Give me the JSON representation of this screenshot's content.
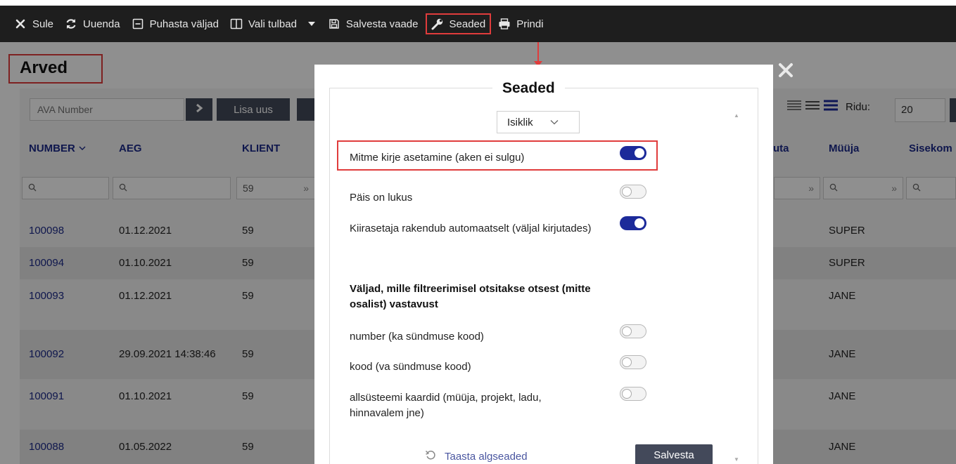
{
  "toolbar": {
    "close": "Sule",
    "refresh": "Uuenda",
    "clear": "Puhasta väljad",
    "columns": "Vali tulbad",
    "save_view": "Salvesta vaade",
    "settings": "Seaded",
    "print": "Prindi"
  },
  "page": {
    "title": "Arved",
    "search_placeholder": "AVA Number",
    "add_new": "Lisa uus",
    "rows_label": "Ridu:",
    "rows_value": "20"
  },
  "table": {
    "headers": {
      "number": "NUMBER",
      "time": "AEG",
      "client": "KLIENT",
      "currency_partial": "uta",
      "seller": "Müüja",
      "internal_partial": "Sisekom"
    },
    "filters": {
      "client": "59"
    },
    "rows": [
      {
        "number": "100098",
        "date": "01.12.2021",
        "client": "59",
        "seller": "SUPER"
      },
      {
        "number": "100094",
        "date": "01.10.2021",
        "client": "59",
        "seller": "SUPER"
      },
      {
        "number": "100093",
        "date": "01.12.2021",
        "client": "59",
        "seller": "JANE"
      },
      {
        "number": "100092",
        "date": "29.09.2021 14:38:46",
        "client": "59",
        "seller": "JANE"
      },
      {
        "number": "100091",
        "date": "01.10.2021",
        "client": "59",
        "seller": "JANE"
      },
      {
        "number": "100088",
        "date": "01.05.2022",
        "client": "59",
        "seller": "JANE"
      }
    ]
  },
  "modal": {
    "title": "Seaded",
    "scope_select": "Isiklik",
    "options": [
      {
        "label": "Mitme kirje asetamine (aken ei sulgu)",
        "on": true
      },
      {
        "label": "Päis on lukus",
        "on": false
      },
      {
        "label": "Kiirasetaja rakendub automaatselt (väljal kirjutades)",
        "on": true
      }
    ],
    "section_heading": "Väljad, mille filtreerimisel otsitakse otsest (mitte osalist) vastavust",
    "exact_options": [
      {
        "label": "number (ka sündmuse kood)",
        "on": false
      },
      {
        "label": "kood (va sündmuse kood)",
        "on": false
      },
      {
        "label": "allsüsteemi kaardid (müüja, projekt, ladu, hinnavalem jne)",
        "on": false
      }
    ],
    "restore_label": "Taasta algseaded",
    "save_label": "Salvesta"
  },
  "colors": {
    "highlight": "#e03c3c",
    "accent": "#1c2a9a",
    "button": "#43495a",
    "toolbar": "#1e1e1e"
  }
}
